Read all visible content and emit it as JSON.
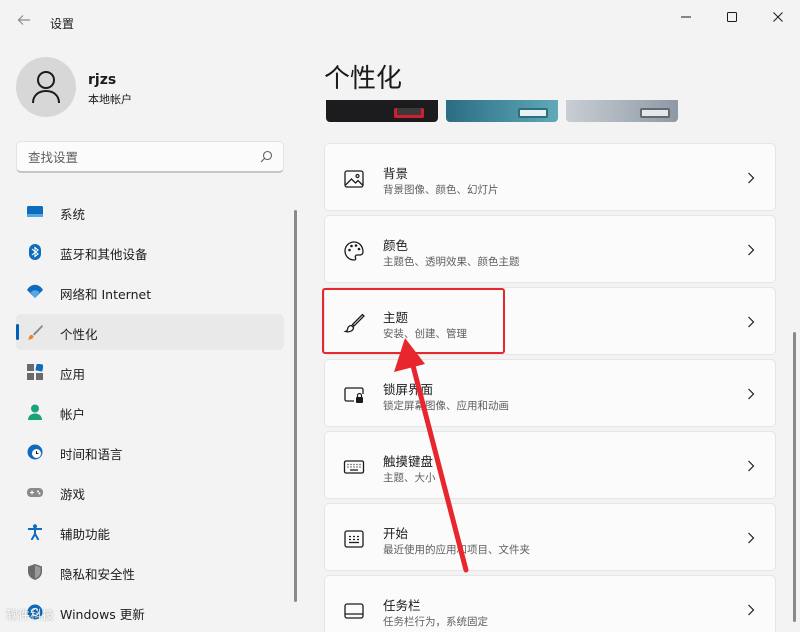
{
  "window": {
    "app_title": "设置",
    "back_icon": "back-arrow-icon",
    "controls": [
      "minimize-icon",
      "maximize-icon",
      "close-icon"
    ]
  },
  "user": {
    "name": "rjzs",
    "account_type": "本地帐户"
  },
  "search": {
    "placeholder": "查找设置",
    "value": ""
  },
  "sidebar": {
    "active_index": 3,
    "items": [
      {
        "label": "系统",
        "icon": "system-display-icon"
      },
      {
        "label": "蓝牙和其他设备",
        "icon": "bluetooth-icon"
      },
      {
        "label": "网络和 Internet",
        "icon": "wifi-icon"
      },
      {
        "label": "个性化",
        "icon": "brush-icon"
      },
      {
        "label": "应用",
        "icon": "apps-icon"
      },
      {
        "label": "帐户",
        "icon": "account-icon"
      },
      {
        "label": "时间和语言",
        "icon": "globe-clock-icon"
      },
      {
        "label": "游戏",
        "icon": "gamepad-icon"
      },
      {
        "label": "辅助功能",
        "icon": "accessibility-icon"
      },
      {
        "label": "隐私和安全性",
        "icon": "shield-icon"
      },
      {
        "label": "Windows 更新",
        "icon": "update-icon"
      }
    ]
  },
  "main": {
    "title": "个性化",
    "cards": [
      {
        "title": "背景",
        "subtitle": "背景图像、颜色、幻灯片",
        "icon": "image-icon"
      },
      {
        "title": "颜色",
        "subtitle": "主题色、透明效果、颜色主题",
        "icon": "palette-icon"
      },
      {
        "title": "主题",
        "subtitle": "安装、创建、管理",
        "icon": "brush-icon"
      },
      {
        "title": "锁屏界面",
        "subtitle": "锁定屏幕图像、应用和动画",
        "icon": "lock-screen-icon"
      },
      {
        "title": "触摸键盘",
        "subtitle": "主题、大小",
        "icon": "keyboard-icon"
      },
      {
        "title": "开始",
        "subtitle": "最近使用的应用和项目、文件夹",
        "icon": "start-menu-icon"
      },
      {
        "title": "任务栏",
        "subtitle": "任务栏行为，系统固定",
        "icon": "taskbar-icon"
      }
    ]
  },
  "annotation": {
    "highlighted_card": "主题",
    "color": "#e8262d"
  },
  "watermark": "软件科技",
  "colors": {
    "accent": "#005fb8",
    "background": "#f3f3f3",
    "card": "#fbfbfb"
  }
}
